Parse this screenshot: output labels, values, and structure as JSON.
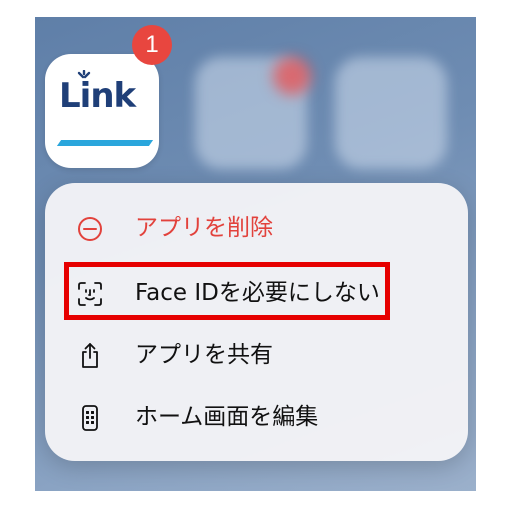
{
  "app": {
    "name": "Link",
    "badge_count": "1",
    "accent_color": "#2aa6dc",
    "logo_color": "#1f3f78"
  },
  "menu": {
    "items": [
      {
        "label": "アプリを削除",
        "icon": "minus-circle-icon",
        "style": "danger"
      },
      {
        "label": "Face IDを必要にしない",
        "icon": "face-id-icon",
        "style": "normal"
      },
      {
        "label": "アプリを共有",
        "icon": "share-icon",
        "style": "normal"
      },
      {
        "label": "ホーム画面を編集",
        "icon": "phone-icon",
        "style": "normal"
      }
    ]
  },
  "colors": {
    "danger": "#e2423c",
    "highlight": "#e60000",
    "badge": "#e8463f"
  }
}
